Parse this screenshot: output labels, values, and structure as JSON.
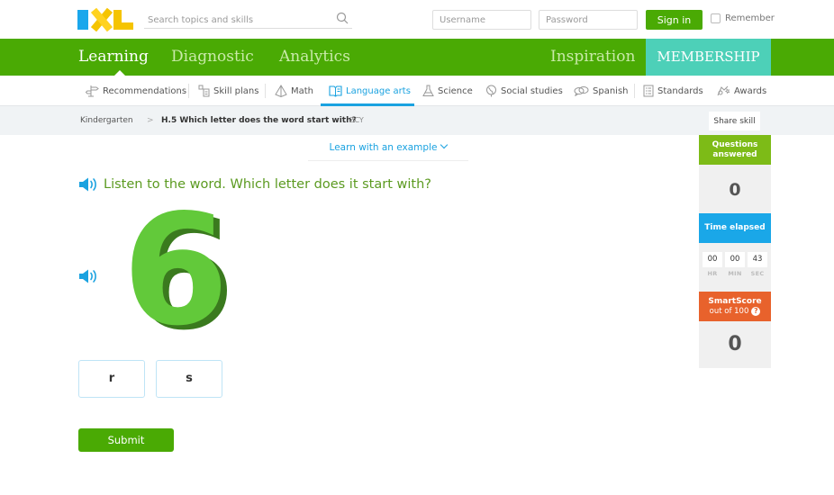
{
  "header": {
    "logo": "IXL",
    "search_placeholder": "Search topics and skills",
    "username_placeholder": "Username",
    "password_placeholder": "Password",
    "signin_label": "Sign in",
    "remember_label": "Remember"
  },
  "main_nav": {
    "items": [
      {
        "label": "Learning",
        "active": true
      },
      {
        "label": "Diagnostic",
        "active": false
      },
      {
        "label": "Analytics",
        "active": false
      },
      {
        "label": "Inspiration",
        "active": false
      }
    ],
    "membership_label": "MEMBERSHIP"
  },
  "sub_nav": {
    "items": [
      {
        "label": "Recommendations",
        "icon": "signpost-icon"
      },
      {
        "label": "Skill plans",
        "icon": "skill-plan-icon"
      },
      {
        "label": "Math",
        "icon": "pyramid-icon"
      },
      {
        "label": "Language arts",
        "icon": "book-icon",
        "active": true
      },
      {
        "label": "Science",
        "icon": "flask-icon"
      },
      {
        "label": "Social studies",
        "icon": "globe-icon"
      },
      {
        "label": "Spanish",
        "icon": "speech-bubbles-icon"
      },
      {
        "label": "Standards",
        "icon": "list-icon"
      },
      {
        "label": "Awards",
        "icon": "awards-icon"
      }
    ]
  },
  "breadcrumb": {
    "grade": "Kindergarten",
    "separator": ">",
    "skill": "H.5 Which letter does the word start with?",
    "code": "ZCY",
    "share_label": "Share skill"
  },
  "practice": {
    "learn_example": "Learn with an example",
    "question": "Listen to the word. Which letter does it start with?",
    "image_label": "6",
    "answers": [
      "r",
      "s"
    ],
    "submit_label": "Submit"
  },
  "stats": {
    "questions_answered_label": "Questions answered",
    "questions_answered": "0",
    "time_elapsed_label": "Time elapsed",
    "time": {
      "hr": "00",
      "min": "00",
      "sec": "43"
    },
    "time_units": {
      "hr": "HR",
      "min": "MIN",
      "sec": "SEC"
    },
    "smartscore_label": "SmartScore",
    "smartscore_sub": "out of 100",
    "smartscore_help": "?",
    "smartscore": "0"
  },
  "colors": {
    "brand_green": "#4aaa04",
    "membership_teal": "#4dd0b8",
    "accent_blue": "#1aa2e0",
    "question_green": "#5b9a20",
    "smartscore_orange": "#e8622c"
  }
}
